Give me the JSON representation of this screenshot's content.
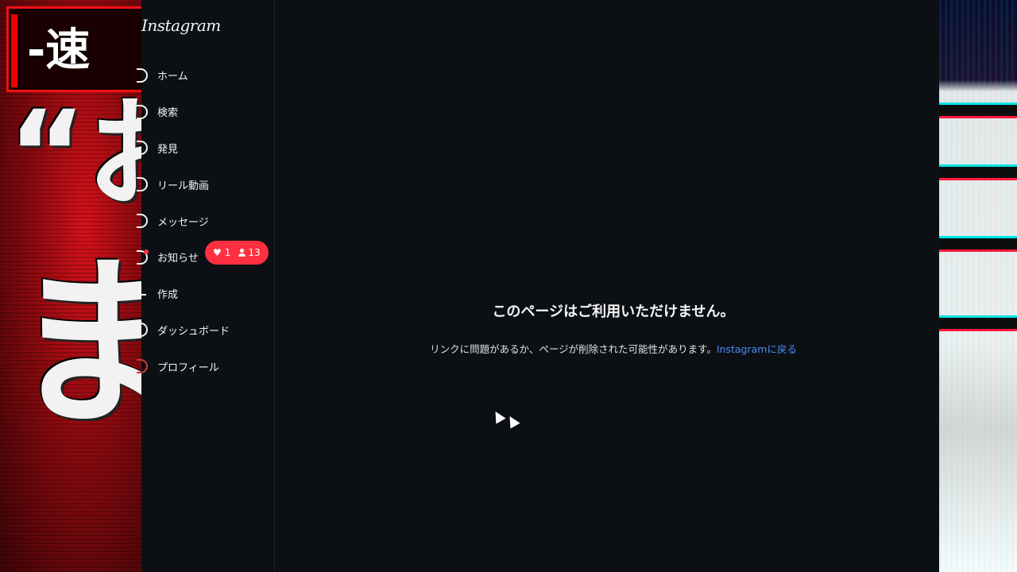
{
  "app": {
    "logo_text": "Instagram"
  },
  "background": {
    "left_banner_text": "‐速",
    "left_glyph_1": "“お",
    "left_glyph_2": "ま"
  },
  "sidebar": {
    "items": [
      {
        "label": "ホーム",
        "icon": "home-icon"
      },
      {
        "label": "検索",
        "icon": "search-icon"
      },
      {
        "label": "発見",
        "icon": "explore-icon"
      },
      {
        "label": "リール動画",
        "icon": "reels-icon"
      },
      {
        "label": "メッセージ",
        "icon": "messenger-icon"
      },
      {
        "label": "お知らせ",
        "icon": "heart-icon"
      },
      {
        "label": "作成",
        "icon": "create-icon"
      },
      {
        "label": "ダッシュボード",
        "icon": "dashboard-icon"
      },
      {
        "label": "プロフィール",
        "icon": "profile-avatar-icon"
      }
    ],
    "notification_badge": {
      "likes": "1",
      "follows": "13"
    }
  },
  "main": {
    "error_title": "このページはご利用いただけません。",
    "error_description": "リンクに問題があるか、ページが削除された可能性があります。",
    "back_link": "Instagramに戻る"
  },
  "colors": {
    "background": "#0c1014",
    "badge": "#ff3040",
    "link": "#4a8df7"
  }
}
